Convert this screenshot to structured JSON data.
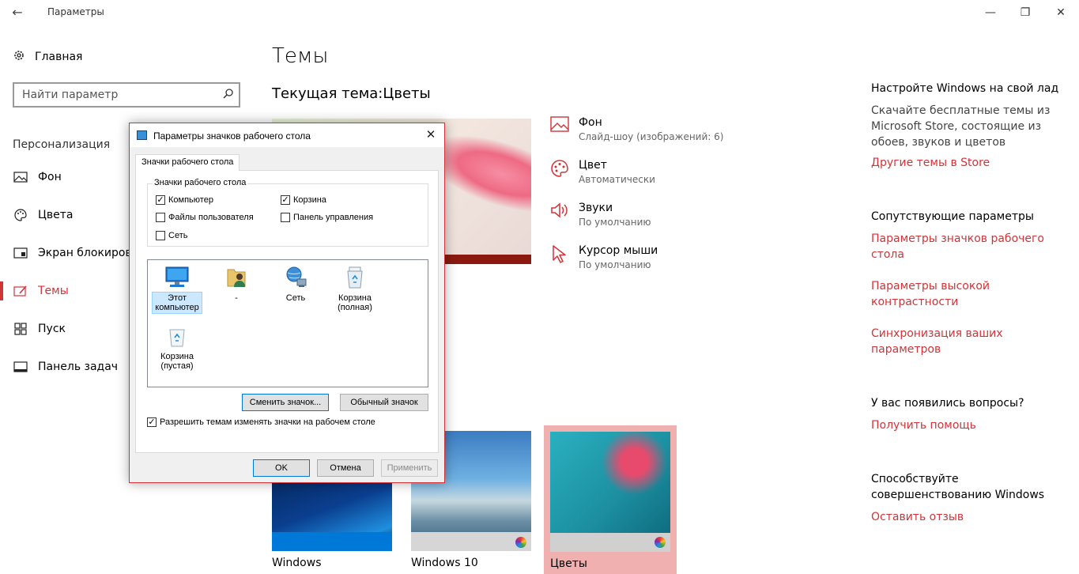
{
  "window": {
    "back": "←",
    "title": "Параметры",
    "minimize": "—",
    "restore": "❐",
    "close": "✕"
  },
  "sidebar": {
    "home": "Главная",
    "search_placeholder": "Найти параметр",
    "section": "Персонализация",
    "items": [
      {
        "label": "Фон",
        "icon": "image-icon"
      },
      {
        "label": "Цвета",
        "icon": "palette-icon"
      },
      {
        "label": "Экран блокировки",
        "icon": "lock-screen-icon"
      },
      {
        "label": "Темы",
        "icon": "brush-icon",
        "active": true
      },
      {
        "label": "Пуск",
        "icon": "start-icon"
      },
      {
        "label": "Панель задач",
        "icon": "taskbar-icon"
      }
    ]
  },
  "main": {
    "title": "Темы",
    "current_theme_label": "Текущая тема:",
    "current_theme_value": "Цветы",
    "settings": [
      {
        "title": "Фон",
        "sub": "Слайд-шоу (изображений: 6)",
        "icon": "image-icon"
      },
      {
        "title": "Цвет",
        "sub": "Автоматически",
        "icon": "palette-icon"
      },
      {
        "title": "Звуки",
        "sub": "По умолчанию",
        "icon": "speaker-icon"
      },
      {
        "title": "Курсор мыши",
        "sub": "По умолчанию",
        "icon": "cursor-icon"
      }
    ],
    "themes": [
      {
        "label": "Windows"
      },
      {
        "label": "Windows 10"
      },
      {
        "label": "Цветы",
        "selected": true
      }
    ]
  },
  "right_panel": {
    "customize_head": "Настройте Windows на свой лад",
    "customize_text": "Скачайте бесплатные темы из Microsoft Store, состоящие из обоев, звуков и цветов",
    "store_link": "Другие темы в Store",
    "related_head": "Сопутствующие параметры",
    "related_links": [
      "Параметры значков рабочего стола",
      "Параметры высокой контрастности",
      "Синхронизация ваших параметров"
    ],
    "questions_head": "У вас появились вопросы?",
    "help_link": "Получить помощь",
    "improve_head": "Способствуйте совершенствованию Windows",
    "feedback_link": "Оставить отзыв"
  },
  "dialog": {
    "title": "Параметры значков рабочего стола",
    "close": "✕",
    "tab": "Значки рабочего стола",
    "group_label": "Значки рабочего стола",
    "checkboxes": [
      {
        "label": "Компьютер",
        "checked": true
      },
      {
        "label": "Корзина",
        "checked": true
      },
      {
        "label": "Файлы пользователя",
        "checked": false
      },
      {
        "label": "Панель управления",
        "checked": false
      },
      {
        "label": "Сеть",
        "checked": false
      }
    ],
    "icons": [
      {
        "label": "Этот компьютер",
        "selected": true,
        "icon": "computer-icon"
      },
      {
        "label": "-",
        "icon": "user-folder-icon"
      },
      {
        "label": "Сеть",
        "icon": "network-icon"
      },
      {
        "label": "Корзина (полная)",
        "icon": "recycle-bin-full-icon"
      },
      {
        "label": "Корзина (пустая)",
        "icon": "recycle-bin-empty-icon"
      }
    ],
    "change_icon_button": "Сменить значок...",
    "default_icon_button": "Обычный значок",
    "allow_themes_label": "Разрешить темам изменять значки на рабочем столе",
    "allow_themes_checked": true,
    "ok_button": "OK",
    "cancel_button": "Отмена",
    "apply_button": "Применить",
    "check_mark": "✓"
  },
  "colors": {
    "accent": "#d13438",
    "link": "#d13438"
  }
}
